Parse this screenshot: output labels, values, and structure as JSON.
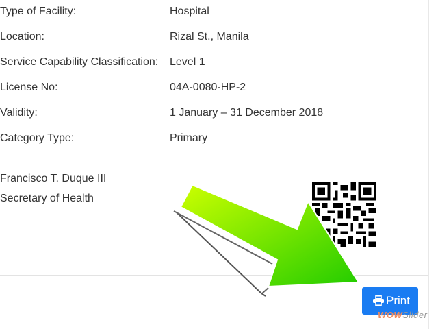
{
  "details": {
    "rows": [
      {
        "label": "Type of Facility:",
        "value": "Hospital"
      },
      {
        "label": "Location:",
        "value": "Rizal St., Manila"
      },
      {
        "label": "Service Capability Classification:",
        "value": "Level 1"
      },
      {
        "label": "License No:",
        "value": "04A-0080-HP-2"
      },
      {
        "label": "Validity:",
        "value": "1 January – 31 December 2018"
      },
      {
        "label": "Category Type:",
        "value": "Primary"
      }
    ]
  },
  "signatory": {
    "name": "Francisco T. Duque III",
    "title": "Secretary of Health"
  },
  "print_button": {
    "label": "Print",
    "icon": "printer-icon"
  },
  "watermark": {
    "part1": "WOW",
    "part2": "Slider"
  },
  "colors": {
    "button": "#1a7cf2",
    "arrow_light": "#ccff00",
    "arrow_dark": "#22cc00"
  }
}
